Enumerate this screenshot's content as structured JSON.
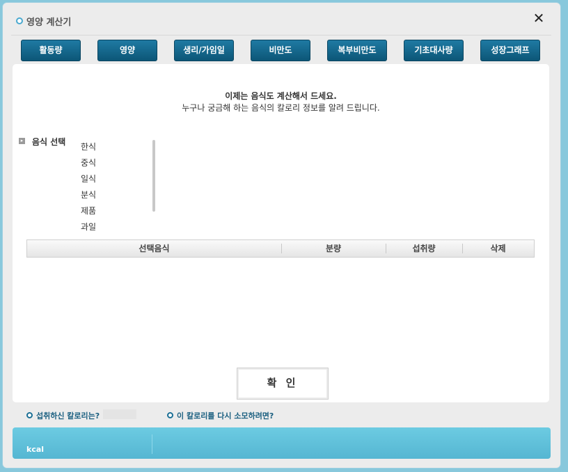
{
  "window": {
    "title": "영양 계산기",
    "close_icon": "close-icon"
  },
  "tabs": [
    {
      "label": "활동량"
    },
    {
      "label": "영양"
    },
    {
      "label": "생리/가임일"
    },
    {
      "label": "비만도"
    },
    {
      "label": "복부비만도"
    },
    {
      "label": "기초대사량"
    },
    {
      "label": "성장그래프"
    }
  ],
  "intro": {
    "line1": "이제는 음식도 계산해서 드세요.",
    "line2": "누구나 궁금해 하는 음식의 칼로리 정보를 알려 드립니다."
  },
  "food_select": {
    "label": "음식 선택",
    "categories": [
      "한식",
      "중식",
      "일식",
      "분식",
      "제품",
      "과일"
    ]
  },
  "table": {
    "headers": [
      "선택음식",
      "분량",
      "섭취량",
      "삭제"
    ]
  },
  "confirm_label": "확 인",
  "questions": {
    "intake": "섭취하신 칼로리는?",
    "burn": "이 칼로리를 다시 소모하려면?"
  },
  "result": {
    "unit": "kcal"
  },
  "colors": {
    "tab_bg": "#0c5677",
    "accent": "#4aa9d0",
    "result_bar": "#5fc0da"
  }
}
